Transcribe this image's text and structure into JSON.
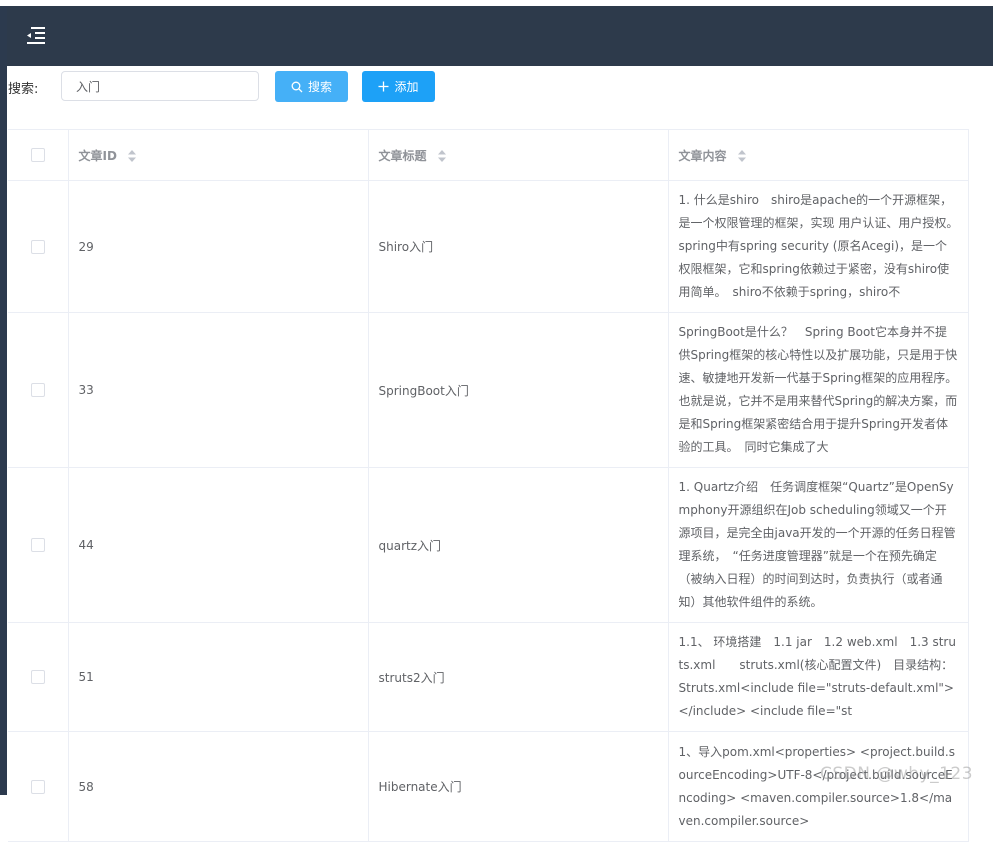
{
  "navbar": {
    "background": "#2d3a4b",
    "toggle_icon": "menu-fold-icon"
  },
  "search": {
    "label": "搜索:",
    "value": "入门",
    "search_button": "搜索",
    "add_button": "添加"
  },
  "table": {
    "headers": {
      "id": "文章ID",
      "title": "文章标题",
      "content": "文章内容"
    },
    "rows": [
      {
        "id": "29",
        "title": "Shiro入门",
        "content": "1. 什么是shiro　shiro是apache的一个开源框架，是一个权限管理的框架，实现 用户认证、用户授权。　spring中有spring security (原名Acegi)，是一个权限框架，它和spring依赖过于紧密，没有shiro使用简单。　shiro不依赖于spring，shiro不"
      },
      {
        "id": "33",
        "title": "SpringBoot入门",
        "content": "SpringBoot是什么？　Spring Boot它本身并不提供Spring框架的核心特性以及扩展功能，只是用于快速、敏捷地开发新一代基于Spring框架的应用程序。也就是说，它并不是用来替代Spring的解决方案，而是和Spring框架紧密结合用于提升Spring开发者体验的工具。　同时它集成了大"
      },
      {
        "id": "44",
        "title": "quartz入门",
        "content": "1. Quartz介绍　任务调度框架“Quartz”是OpenSymphony开源组织在Job scheduling领域又一个开源项目，是完全由java开发的一个开源的任务日程管理系统，　“任务进度管理器”就是一个在预先确定（被纳入日程）的时间到达时，负责执行（或者通知）其他软件组件的系统。"
      },
      {
        "id": "51",
        "title": "struts2入门",
        "content": "1.1、 环境搭建　1.1 jar　1.2 web.xml　1.3 struts.xml　　struts.xml(核心配置文件)　目录结构：　Struts.xml<include file=\"struts-default.xml\"></include> <include file=\"st"
      },
      {
        "id": "58",
        "title": "Hibernate入门",
        "content": "1、导入pom.xml<properties> <project.build.sourceEncoding>UTF-8</project.build.sourceEncoding> <maven.compiler.source>1.8</maven.compiler.source>"
      }
    ]
  },
  "watermark": "CSDN @why_123"
}
